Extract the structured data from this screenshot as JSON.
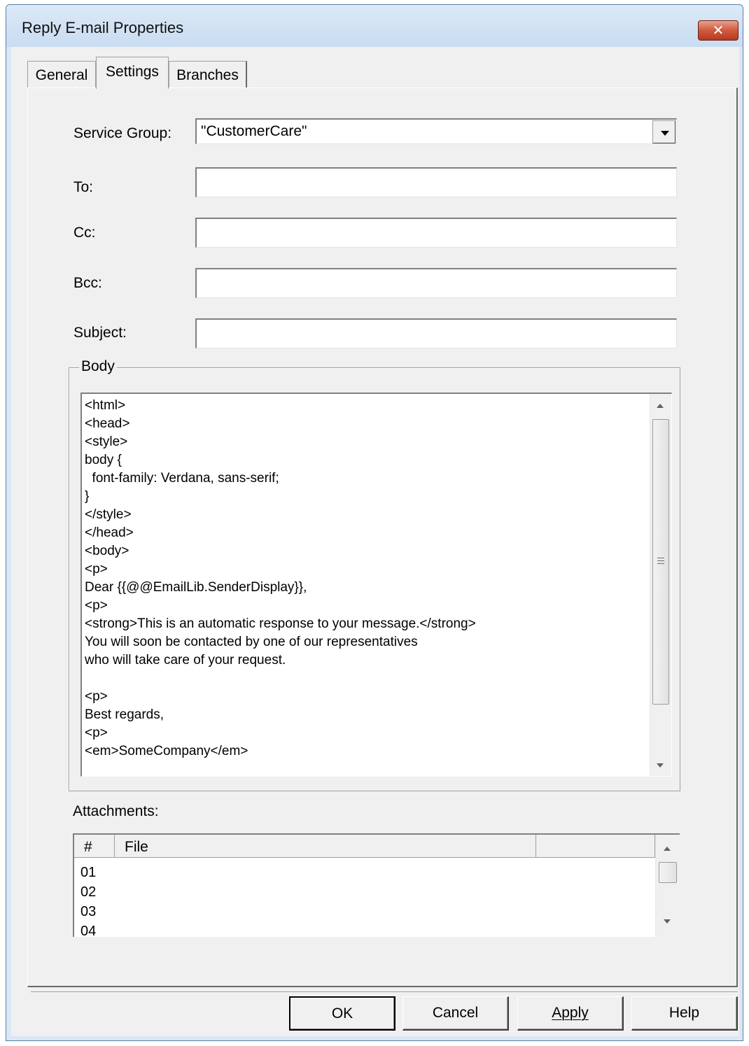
{
  "window": {
    "title": "Reply E-mail Properties",
    "close_label": "✕"
  },
  "tabs": [
    {
      "label": "General"
    },
    {
      "label": "Settings"
    },
    {
      "label": "Branches"
    }
  ],
  "form": {
    "service_group": {
      "label": "Service Group:",
      "value": "\"CustomerCare\""
    },
    "to": {
      "label": "To:",
      "value": ""
    },
    "cc": {
      "label": "Cc:",
      "value": ""
    },
    "bcc": {
      "label": "Bcc:",
      "value": ""
    },
    "subject": {
      "label": "Subject:",
      "value": ""
    }
  },
  "body": {
    "group_label": "Body",
    "lines": [
      "<html>",
      "<head>",
      "<style>",
      "body {",
      "  font-family: Verdana, sans-serif;",
      "}",
      "</style>",
      "</head>",
      "<body>",
      "<p>",
      "Dear {{@@EmailLib.SenderDisplay}},",
      "<p>",
      "<strong>This is an automatic response to your message.</strong>",
      "You will soon be contacted by one of our representatives",
      "who will take care of your request.",
      "",
      "<p>",
      "Best regards,",
      "<p>",
      "<em>SomeCompany</em>"
    ]
  },
  "attachments": {
    "label": "Attachments:",
    "columns": [
      "#",
      "File",
      ""
    ],
    "rows": [
      "01",
      "02",
      "03",
      "04"
    ]
  },
  "buttons": {
    "ok": "OK",
    "cancel": "Cancel",
    "apply": "Apply",
    "help": "Help"
  }
}
